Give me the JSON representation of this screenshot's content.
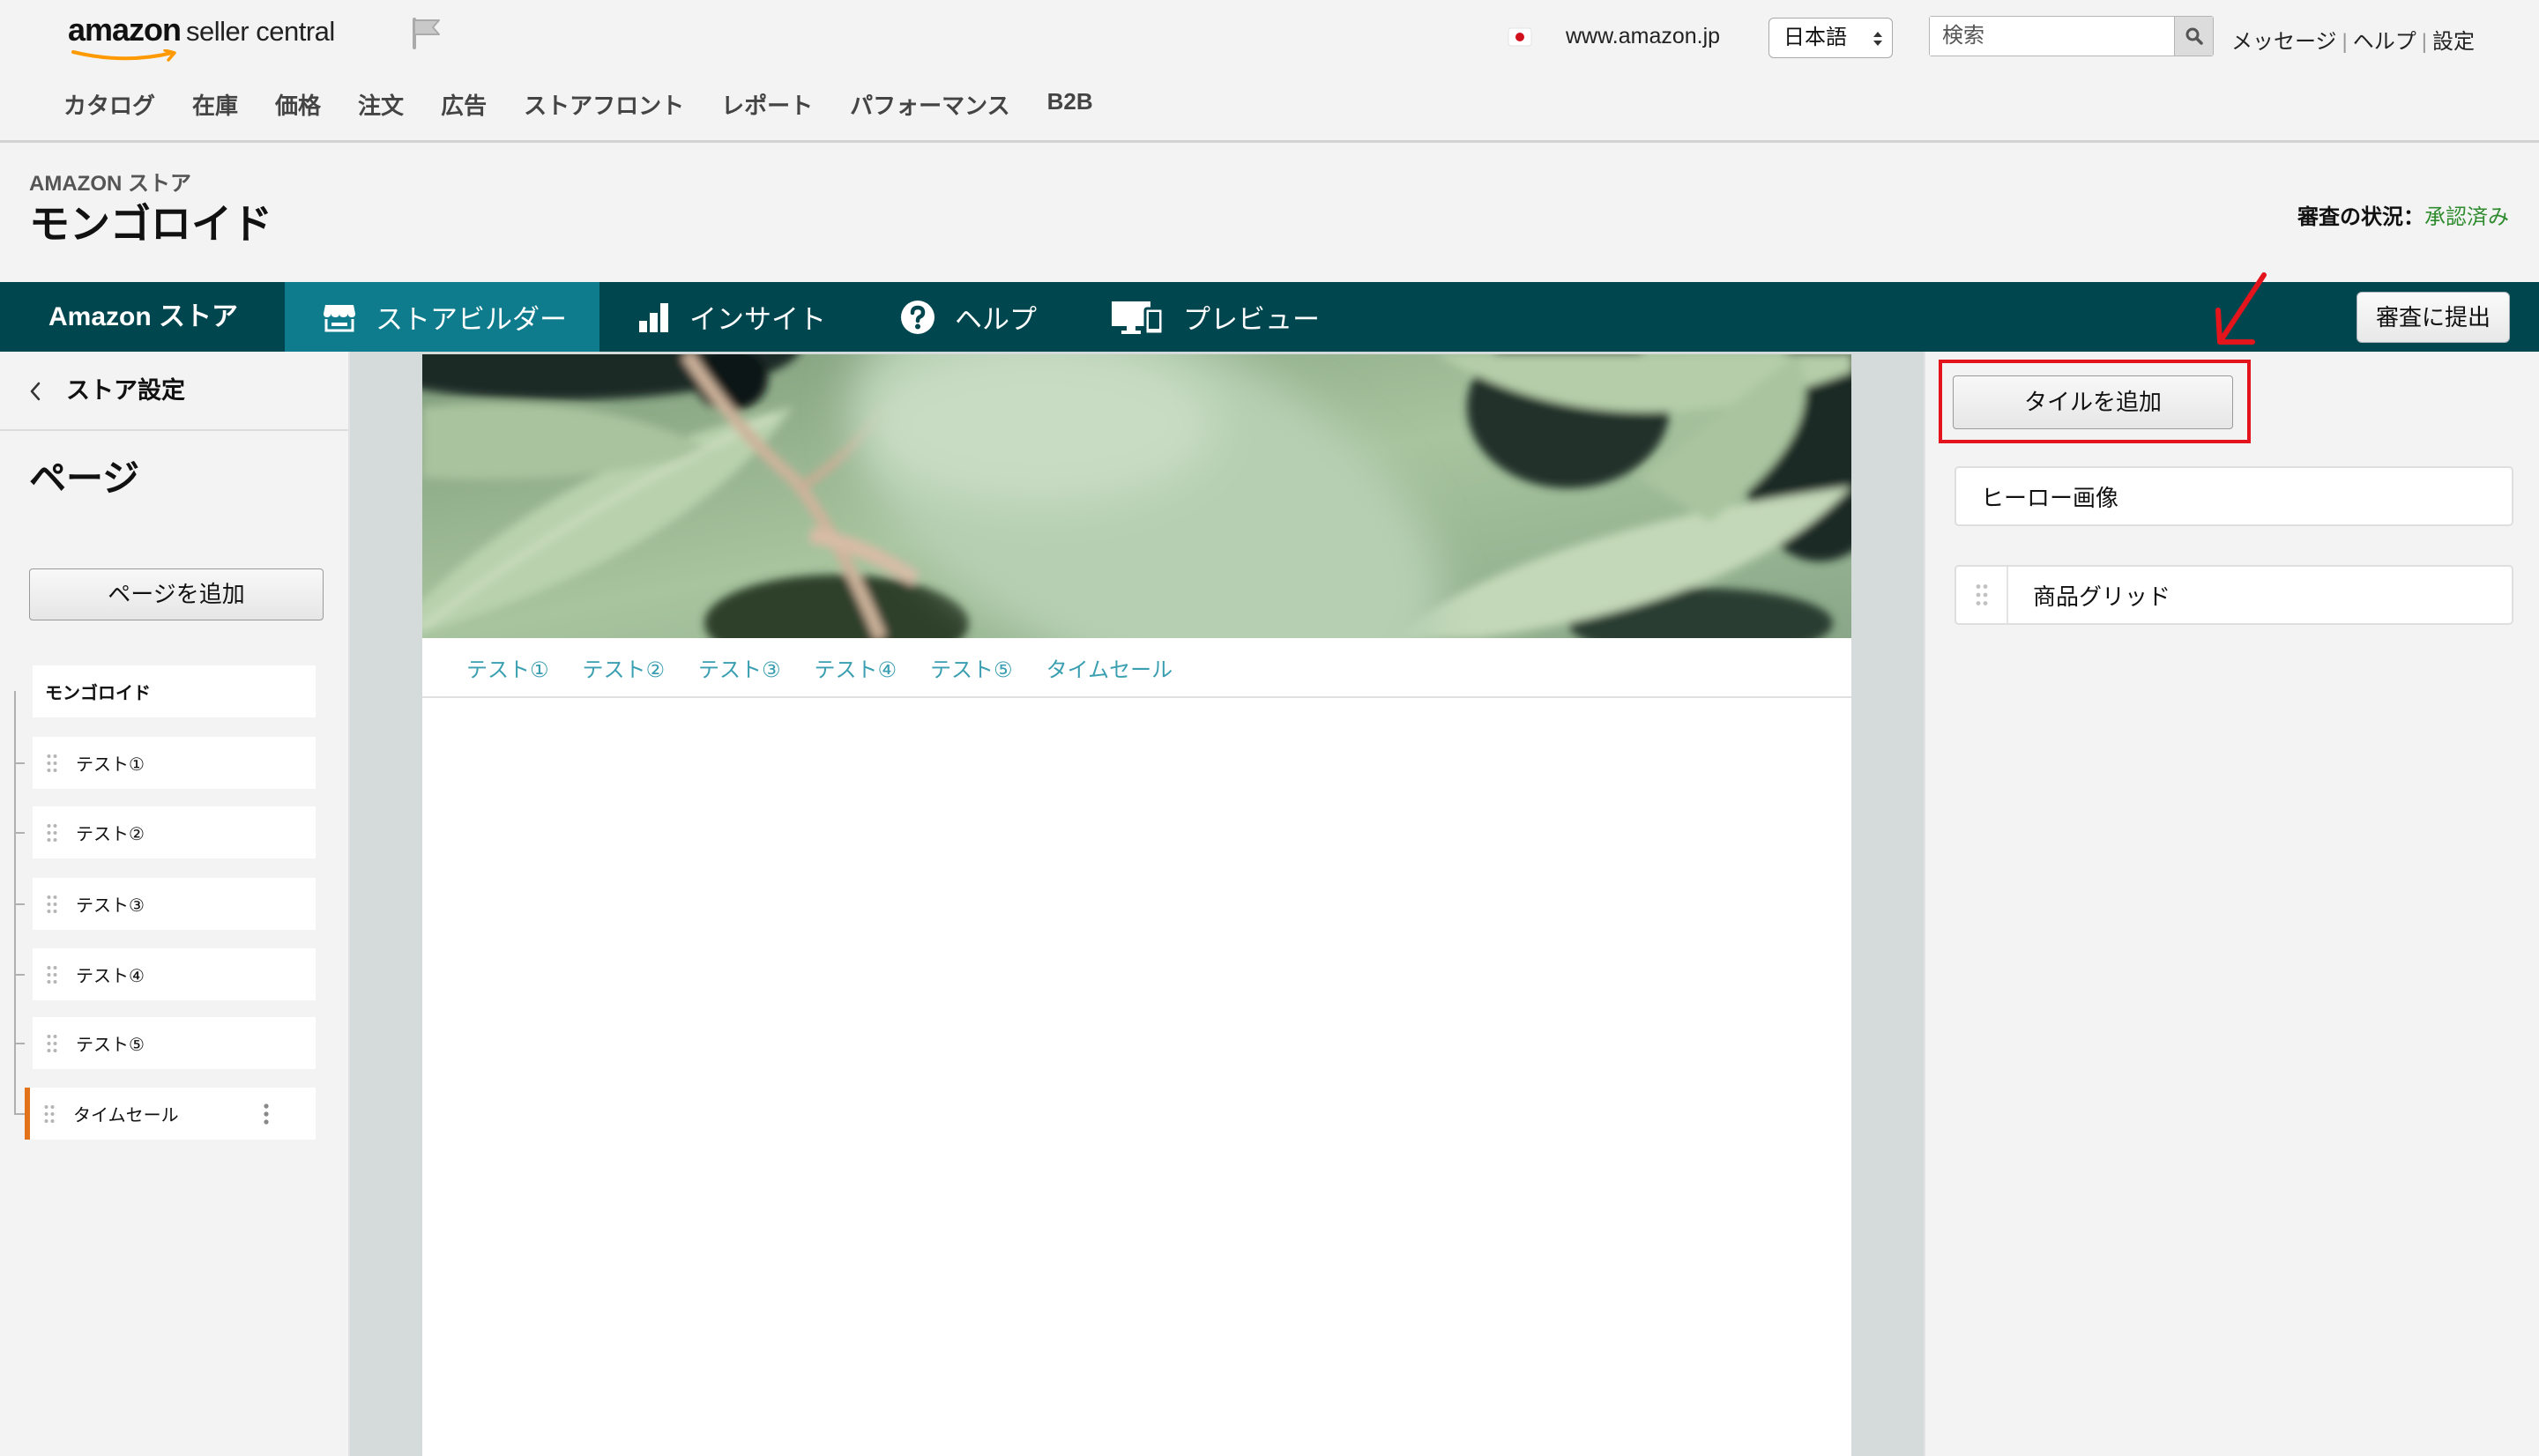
{
  "header": {
    "logo": {
      "brand": "amazon",
      "product": "seller central"
    },
    "marketplace": "www.amazon.jp",
    "language": "日本語",
    "search_placeholder": "検索",
    "links": [
      "メッセージ",
      "ヘルプ",
      "設定"
    ],
    "separator": "|"
  },
  "topnav": {
    "items": [
      "カタログ",
      "在庫",
      "価格",
      "注文",
      "広告",
      "ストアフロント",
      "レポート",
      "パフォーマンス",
      "B2B"
    ]
  },
  "store": {
    "section_label": "AMAZON ストア",
    "name": "モンゴロイド",
    "review_status_label": "審査の状況：",
    "review_status_value": "承認済み"
  },
  "toolbar": {
    "home": "Amazon ストア",
    "tabs": [
      {
        "label": "ストアビルダー",
        "icon": "store-icon",
        "active": true
      },
      {
        "label": "インサイト",
        "icon": "bar-chart-icon",
        "active": false
      },
      {
        "label": "ヘルプ",
        "icon": "question-circle-icon",
        "active": false
      },
      {
        "label": "プレビュー",
        "icon": "monitor-icon",
        "active": false
      }
    ],
    "submit_label": "審査に提出"
  },
  "sidebar": {
    "back_label": "ストア設定",
    "heading": "ページ",
    "add_page_label": "ページを追加",
    "pages": {
      "root": "モンゴロイド",
      "children": [
        "テスト①",
        "テスト②",
        "テスト③",
        "テスト④",
        "テスト⑤",
        "タイムセール"
      ],
      "selected_index": 5
    }
  },
  "canvas": {
    "hero": {
      "icon": "hero-photo-leaves"
    },
    "nav": [
      "テスト①",
      "テスト②",
      "テスト③",
      "テスト④",
      "テスト⑤",
      "タイムセール"
    ]
  },
  "tiles_panel": {
    "add_tile_label": "タイルを追加",
    "tiles": [
      "ヒーロー画像",
      "商品グリッド"
    ]
  },
  "colors": {
    "toolbar_bg": "#00464f",
    "active_tab_bg": "#0e7c8c",
    "status_green": "#2e8b2e",
    "store_nav_link": "#3a9fb0",
    "selected_page_marker": "#e3731a",
    "annotation_red": "#e3141c",
    "canvas_gutter": "#d5dbdb"
  }
}
